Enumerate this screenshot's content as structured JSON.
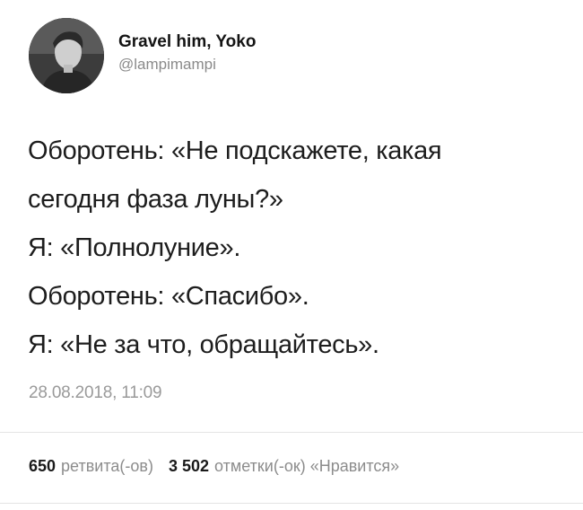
{
  "author": {
    "display_name": "Gravel him, Yoko",
    "handle": "@lampimampi",
    "avatar_icon": "user-avatar-photo"
  },
  "tweet": {
    "lines": [
      "Оборотень: «Не подскажете, какая",
      "сегодня фаза луны?»",
      "Я: «Полнолуние».",
      "Оборотень: «Спасибо».",
      "Я: «Не за что, обращайтесь»."
    ],
    "timestamp": "28.08.2018, 11:09"
  },
  "stats": {
    "retweets_count": "650",
    "retweets_label": "ретвита(-ов)",
    "likes_count": "3 502",
    "likes_label": "отметки(-ок) «Нравится»"
  },
  "colors": {
    "text": "#1d1d1d",
    "secondary": "#8c8c8c",
    "divider": "#e4e4e4"
  }
}
